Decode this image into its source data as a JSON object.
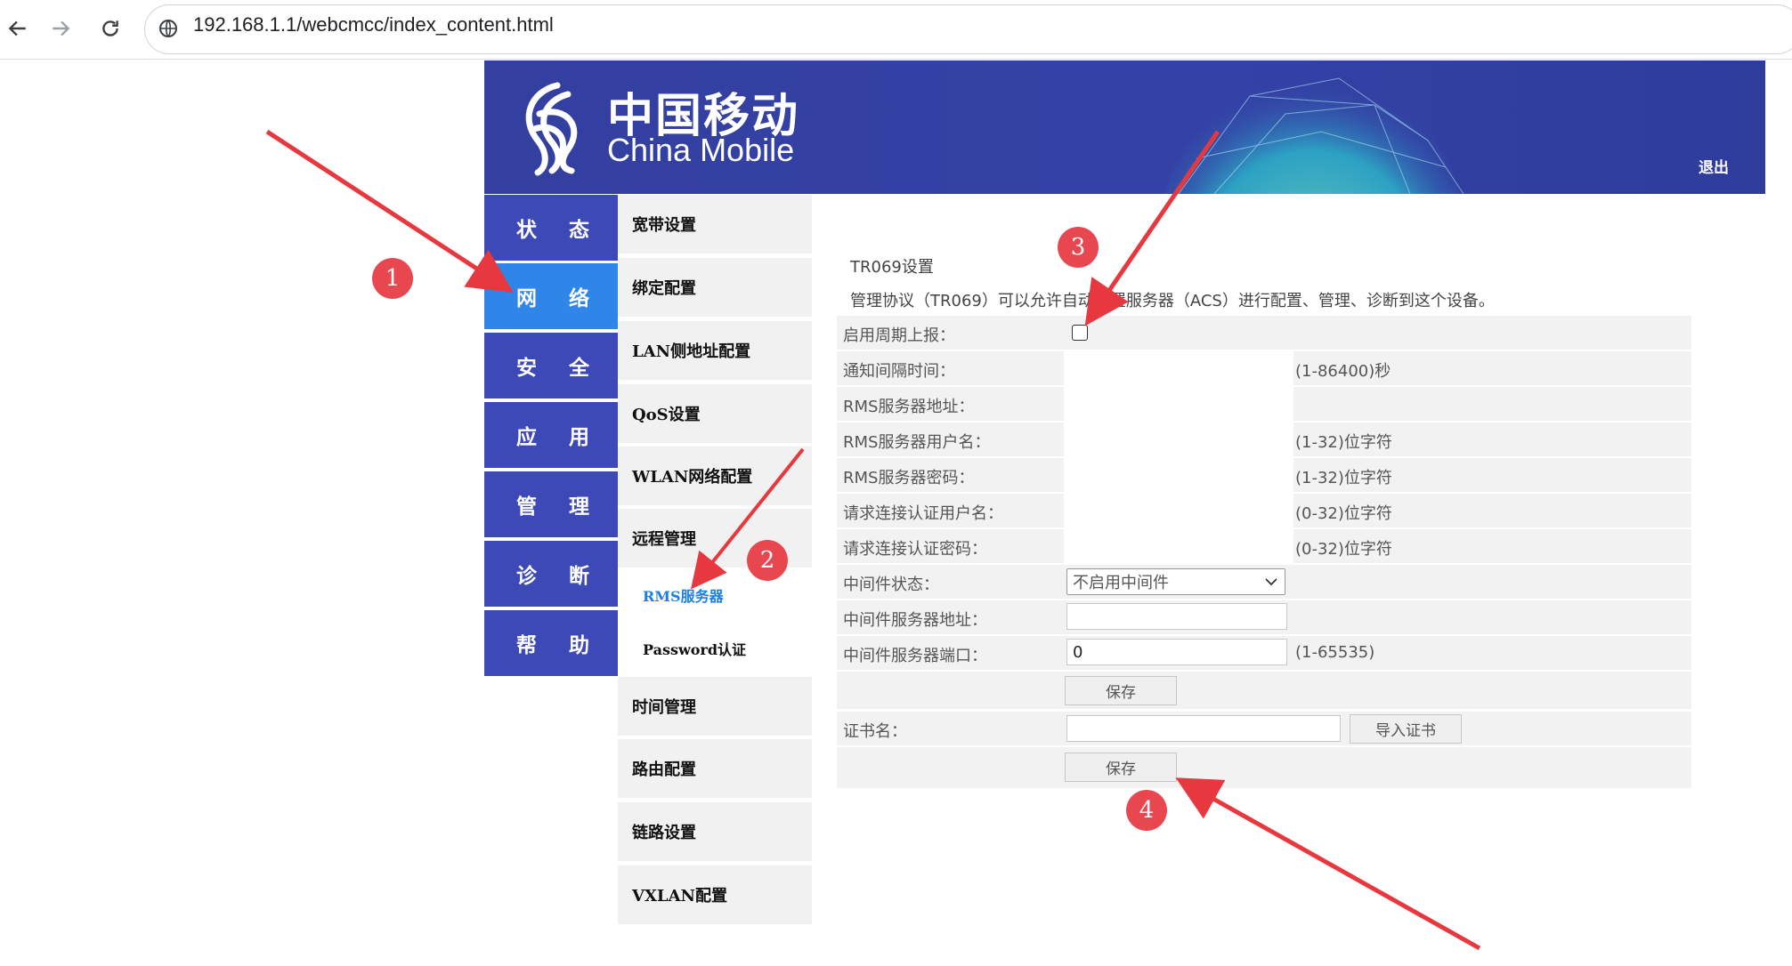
{
  "browser": {
    "url": "192.168.1.1/webcmcc/index_content.html"
  },
  "banner": {
    "brand_cn": "中国移动",
    "brand_en": "China Mobile",
    "logout": "退出"
  },
  "main_nav": [
    "状 态",
    "网 络",
    "安 全",
    "应 用",
    "管 理",
    "诊 断",
    "帮 助"
  ],
  "sub_nav": {
    "items_top": [
      "宽带设置",
      "绑定配置",
      "LAN侧地址配置",
      "QoS设置",
      "WLAN网络配置",
      "远程管理"
    ],
    "remote_children": [
      "RMS服务器",
      "Password认证"
    ],
    "items_bottom": [
      "时间管理",
      "路由配置",
      "链路设置",
      "VXLAN配置"
    ]
  },
  "content": {
    "title": "TR069设置",
    "description": "管理协议（TR069）可以允许自动配置服务器（ACS）进行配置、管理、诊断到这个设备。",
    "labels": {
      "periodic": "启用周期上报：",
      "interval": "通知间隔时间：",
      "rms_addr": "RMS服务器地址：",
      "rms_user": "RMS服务器用户名：",
      "rms_pass": "RMS服务器密码：",
      "conn_user": "请求连接认证用户名：",
      "conn_pass": "请求连接认证密码：",
      "mw_status": "中间件状态：",
      "mw_addr": "中间件服务器地址：",
      "mw_port": "中间件服务器端口：",
      "cert": "证书名："
    },
    "hints": {
      "interval": "(1-86400)秒",
      "rms_user": "(1-32)位字符",
      "rms_pass": "(1-32)位字符",
      "conn_user": "(0-32)位字符",
      "conn_pass": "(0-32)位字符",
      "mw_port": "(1-65535)"
    },
    "mw_status_value": "不启用中间件",
    "mw_port_value": "0",
    "save_label": "保存",
    "import_cert_label": "导入证书"
  },
  "annotations": [
    "1",
    "2",
    "3",
    "4"
  ],
  "colors": {
    "banner": "#3340a0",
    "nav": "#3d49b6",
    "nav_active": "#2f86e8",
    "subnav_bg": "#f1f1f1",
    "arrow": "#e8383f"
  }
}
